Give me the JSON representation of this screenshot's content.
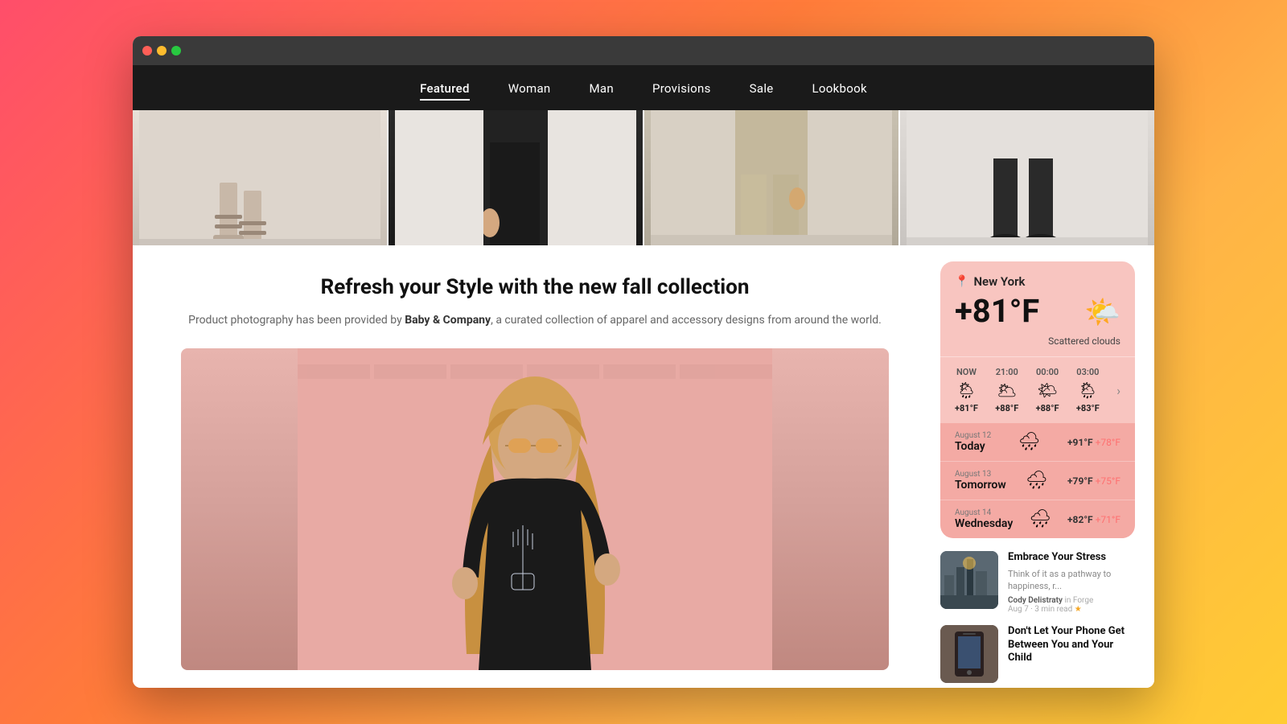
{
  "browser": {
    "dots": [
      "red",
      "yellow",
      "green"
    ]
  },
  "nav": {
    "items": [
      {
        "label": "Featured",
        "active": true
      },
      {
        "label": "Woman",
        "active": false
      },
      {
        "label": "Man",
        "active": false
      },
      {
        "label": "Provisions",
        "active": false
      },
      {
        "label": "Sale",
        "active": false
      },
      {
        "label": "Lookbook",
        "active": false
      }
    ]
  },
  "hero": {
    "title": "Refresh your Style with the new fall collection",
    "desc_pre": "Product photography has been provided by ",
    "brand": "Baby & Company",
    "desc_post": ", a curated collection of apparel and accessory designs from around the world."
  },
  "weather": {
    "location": "New York",
    "temperature": "+81°F",
    "description": "Scattered clouds",
    "hourly": [
      {
        "label": "NOW",
        "icon": "🌦",
        "temp": "+81°F"
      },
      {
        "label": "21:00",
        "icon": "🌥",
        "temp": "+88°F"
      },
      {
        "label": "00:00",
        "icon": "🌤",
        "temp": "+88°F"
      },
      {
        "label": "03:00",
        "icon": "🌦",
        "temp": "+83°F"
      }
    ],
    "daily": [
      {
        "date_label": "August 12",
        "day": "Today",
        "icon": "🌧",
        "high": "+91°F",
        "low": "+78°F"
      },
      {
        "date_label": "August 13",
        "day": "Tomorrow",
        "icon": "🌧",
        "high": "+79°F",
        "low": "+75°F"
      },
      {
        "date_label": "August 14",
        "day": "Wednesday",
        "icon": "🌧",
        "high": "+82°F",
        "low": "+71°F"
      }
    ]
  },
  "blog": {
    "articles": [
      {
        "title": "Embrace Your Stress",
        "excerpt": "Think of it as a pathway to happiness, r...",
        "author": "Cody Delistraty",
        "source": "in Forge",
        "meta": "Aug 7 · 3 min read ★"
      },
      {
        "title": "Don't Let Your Phone Get Between You and Your Child",
        "excerpt": "",
        "author": "",
        "source": "",
        "meta": ""
      }
    ]
  }
}
